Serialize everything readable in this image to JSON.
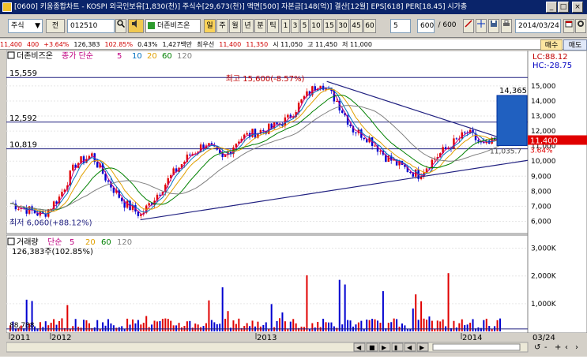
{
  "window": {
    "title": "[0600] 키움종합차트 - KOSPI 외국인보유[1,830(천)] 주식수[29,673(천)] 액면[500] 자본금[148(억)] 결산[12월] EPS[618] PER[18.45] 시가총",
    "btn_min": "_",
    "btn_max": "□",
    "btn_close": "×"
  },
  "toolbar": {
    "market": "주식",
    "market_arrow": "▼",
    "all_label": "전",
    "code": "012510",
    "company": "더존비즈온",
    "period_buttons": [
      "일",
      "주",
      "월",
      "년",
      "분",
      "틱"
    ],
    "minute_buttons": [
      "1",
      "3",
      "5",
      "10",
      "15",
      "30",
      "45",
      "60"
    ],
    "interval": "5",
    "count": "600",
    "count_total": "/ 600",
    "date": "2014/03/24"
  },
  "infobar": {
    "items": [
      "11,400",
      "400",
      "+3.64%",
      "126,383",
      "102.85%",
      "0.43%",
      "1,427백만",
      "최우선",
      "11,400",
      "11,350",
      "시 11,050",
      "고 11,450",
      "저 11,000"
    ],
    "tab_buy": "매수",
    "tab_sell": "매도"
  },
  "price_panel": {
    "title": "더존비즈온",
    "ma_label": "종가 단순",
    "ma_periods": [
      "5",
      "10",
      "20",
      "60",
      "120"
    ],
    "ma_colors": [
      "#c00080",
      "#0070c0",
      "#e0a000",
      "#008000",
      "#808080"
    ],
    "lc_label": "LC:88.12",
    "hc_label": "HC:-28.75",
    "left_levels": [
      "15,559",
      "12,592",
      "10,819"
    ],
    "high_annotation": "최고 15,600(-8.57%)",
    "low_annotation": "최저 6,060(+88.12%)",
    "target_label": "14,365",
    "target_low": "11,035.7",
    "current_price": "11,400",
    "current_change": "3.64%",
    "y_ticks": [
      "15,000",
      "14,000",
      "13,000",
      "12,000",
      "11,000",
      "10,000",
      "9,000",
      "8,000",
      "7,000",
      "6,000"
    ]
  },
  "volume_panel": {
    "title": "거래량",
    "ma_label": "단순",
    "ma_periods": [
      "5",
      "20",
      "60",
      "120"
    ],
    "ma_colors": [
      "#c00080",
      "#e0a000",
      "#008000",
      "#808080"
    ],
    "current": "126,383주(102.85%)",
    "min_label": "88,788",
    "y_ticks": [
      "3,000K",
      "2,000K",
      "1,000K"
    ]
  },
  "x_axis": {
    "labels": [
      "2011",
      "2012",
      "2013",
      "2014"
    ],
    "end_label": "03/24"
  },
  "chart_data": {
    "type": "line",
    "series": [
      {
        "name": "종가",
        "x": [
          "2011-09",
          "2011-10",
          "2011-11",
          "2011-12",
          "2012-01",
          "2012-02",
          "2012-03",
          "2012-04",
          "2012-05",
          "2012-06",
          "2012-07",
          "2012-08",
          "2012-09",
          "2012-10",
          "2012-11",
          "2012-12",
          "2013-01",
          "2013-02",
          "2013-03",
          "2013-04",
          "2013-05",
          "2013-06",
          "2013-07",
          "2013-08",
          "2013-09",
          "2013-10",
          "2013-11",
          "2013-12",
          "2014-01",
          "2014-02",
          "2014-03"
        ],
        "values": [
          7200,
          6800,
          6400,
          7600,
          9800,
          10400,
          8600,
          7200,
          6400,
          7800,
          9200,
          10400,
          11200,
          10100,
          11500,
          11900,
          12200,
          12800,
          14200,
          15300,
          14000,
          12100,
          11500,
          10300,
          9600,
          9100,
          10200,
          11100,
          11900,
          11000,
          11400
        ]
      }
    ],
    "ylim": [
      5500,
      16200
    ],
    "volume": {
      "ylim": [
        0,
        3300000
      ],
      "current": 126383
    }
  }
}
